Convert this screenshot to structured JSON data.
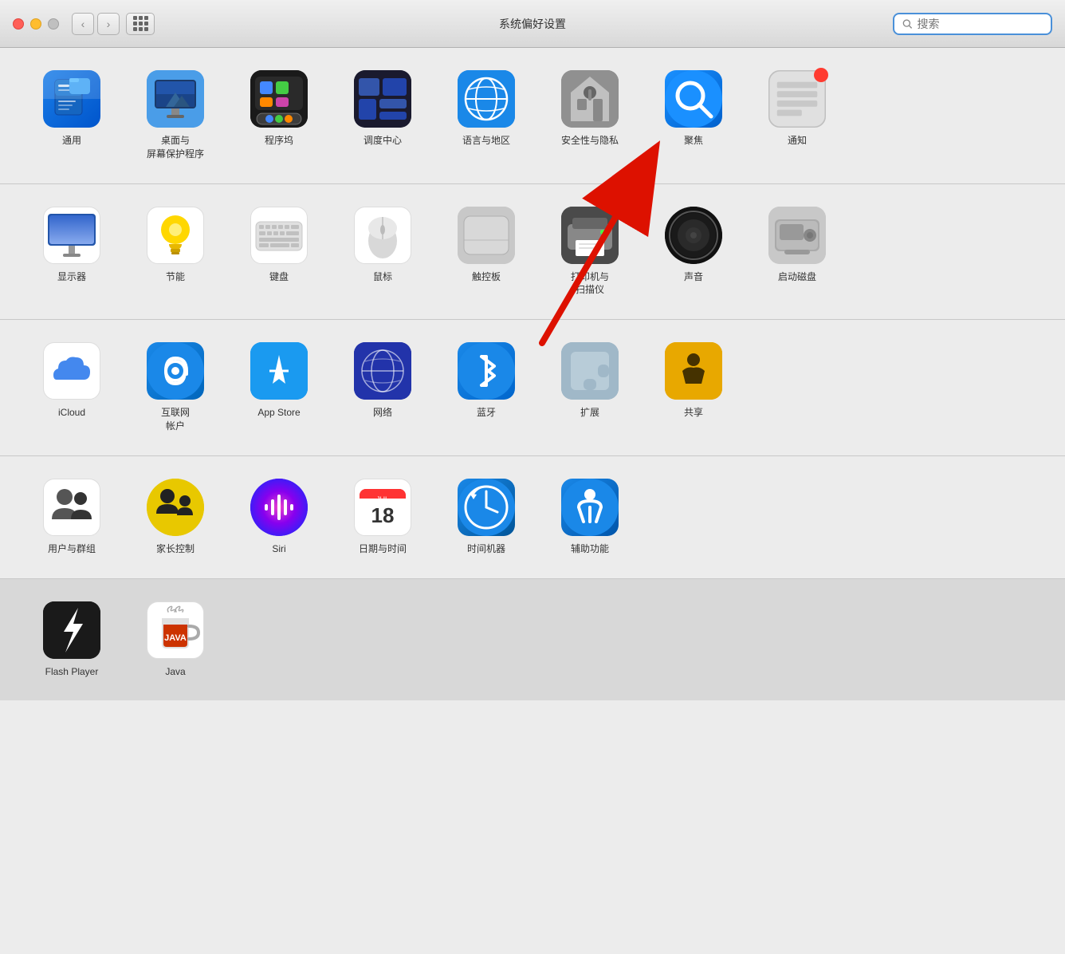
{
  "titlebar": {
    "title": "系统偏好设置",
    "search_placeholder": "搜索"
  },
  "sections": [
    {
      "id": "personal",
      "items": [
        {
          "id": "general",
          "label": "通用"
        },
        {
          "id": "desktop",
          "label": "桌面与\n屏幕保护程序"
        },
        {
          "id": "dock",
          "label": "程序坞"
        },
        {
          "id": "mission",
          "label": "调度中心"
        },
        {
          "id": "language",
          "label": "语言与地区"
        },
        {
          "id": "security",
          "label": "安全性与隐私"
        },
        {
          "id": "spotlight",
          "label": "聚焦"
        },
        {
          "id": "notification",
          "label": "通知"
        }
      ]
    },
    {
      "id": "hardware",
      "items": [
        {
          "id": "display",
          "label": "显示器"
        },
        {
          "id": "energy",
          "label": "节能"
        },
        {
          "id": "keyboard",
          "label": "键盘"
        },
        {
          "id": "mouse",
          "label": "鼠标"
        },
        {
          "id": "trackpad",
          "label": "触控板"
        },
        {
          "id": "printer",
          "label": "打印机与\n扫描仪"
        },
        {
          "id": "sound",
          "label": "声音"
        },
        {
          "id": "startup",
          "label": "启动磁盘"
        }
      ]
    },
    {
      "id": "internet",
      "items": [
        {
          "id": "icloud",
          "label": "iCloud"
        },
        {
          "id": "internet-accounts",
          "label": "互联网\n帐户"
        },
        {
          "id": "appstore",
          "label": "App Store"
        },
        {
          "id": "network",
          "label": "网络"
        },
        {
          "id": "bluetooth",
          "label": "蓝牙"
        },
        {
          "id": "extensions",
          "label": "扩展"
        },
        {
          "id": "sharing",
          "label": "共享"
        }
      ]
    },
    {
      "id": "system",
      "items": [
        {
          "id": "users",
          "label": "用户与群组"
        },
        {
          "id": "parental",
          "label": "家长控制"
        },
        {
          "id": "siri",
          "label": "Siri"
        },
        {
          "id": "datetime",
          "label": "日期与时间"
        },
        {
          "id": "timemachine",
          "label": "时间机器"
        },
        {
          "id": "accessibility",
          "label": "辅助功能"
        }
      ]
    },
    {
      "id": "other",
      "items": [
        {
          "id": "flash",
          "label": "Flash Player"
        },
        {
          "id": "java",
          "label": "Java"
        }
      ]
    }
  ]
}
